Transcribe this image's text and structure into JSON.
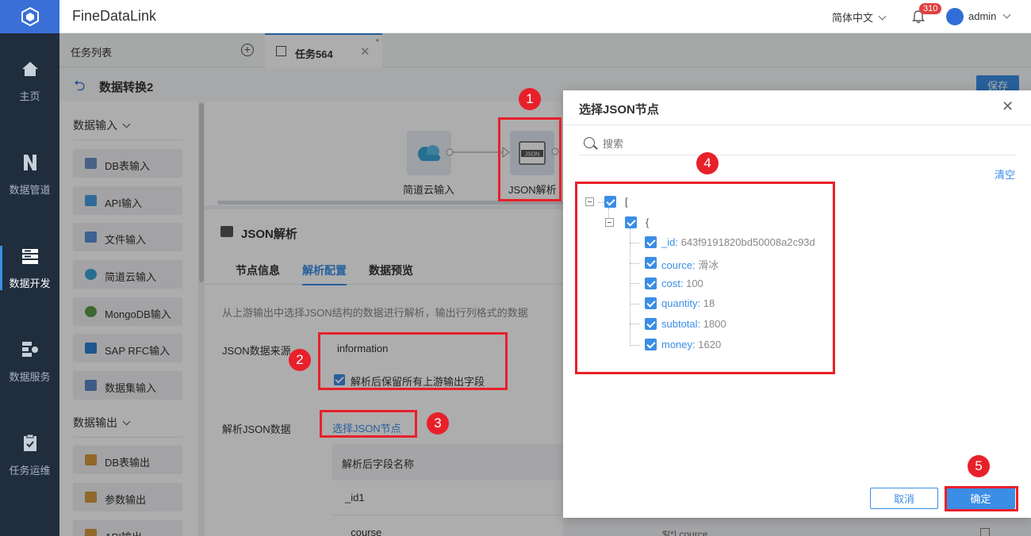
{
  "app": {
    "title": "FineDataLink"
  },
  "nav": {
    "items": [
      {
        "label": "主页"
      },
      {
        "label": "数据管道"
      },
      {
        "label": "数据开发"
      },
      {
        "label": "数据服务"
      },
      {
        "label": "任务运维"
      }
    ]
  },
  "header": {
    "language": "简体中文",
    "notification_count": "310",
    "user": "admin"
  },
  "tabs": {
    "list_label": "任务列表",
    "active_label": "任务564",
    "modified_mark": "*"
  },
  "flow": {
    "title": "数据转换2",
    "save_label": "保存"
  },
  "sidebar": {
    "input_section": "数据输入",
    "input_items": [
      {
        "label": "DB表输入",
        "icon": "db-table-icon"
      },
      {
        "label": "API输入",
        "icon": "api-icon"
      },
      {
        "label": "文件输入",
        "icon": "folder-icon"
      },
      {
        "label": "简道云输入",
        "icon": "jiandaoyun-icon"
      },
      {
        "label": "MongoDB输入",
        "icon": "mongodb-icon"
      },
      {
        "label": "SAP RFC输入",
        "icon": "sap-icon"
      },
      {
        "label": "数据集输入",
        "icon": "dataset-icon"
      }
    ],
    "output_section": "数据输出",
    "output_items": [
      {
        "label": "DB表输出",
        "icon": "db-table-icon"
      },
      {
        "label": "参数输出",
        "icon": "param-icon"
      },
      {
        "label": "API输出",
        "icon": "api-icon"
      }
    ]
  },
  "canvas": {
    "nodes": [
      {
        "label": "简道云输入"
      },
      {
        "label": "JSON解析",
        "badge": "JSON"
      }
    ]
  },
  "config": {
    "title": "JSON解析",
    "tabs": [
      {
        "label": "节点信息"
      },
      {
        "label": "解析配置"
      },
      {
        "label": "数据预览"
      }
    ],
    "active_tab": "解析配置",
    "description": "从上游输出中选择JSON结构的数据进行解析，输出行列格式的数据",
    "source_label": "JSON数据来源",
    "source_value": "information",
    "keep_fields_label": "解析后保留所有上游输出字段",
    "parse_label": "解析JSON数据",
    "select_button": "选择JSON节点",
    "table_header": "解析后字段名称",
    "rows": [
      {
        "name": "_id1"
      },
      {
        "name": "_course",
        "expr": "$[*].cource"
      }
    ]
  },
  "dialog": {
    "title": "选择JSON节点",
    "search_placeholder": "搜索",
    "clear_label": "清空",
    "tree": {
      "root": "[",
      "object": "{",
      "fields": [
        {
          "key": "_id:",
          "value": "643f9191820bd50008a2c93d"
        },
        {
          "key": "cource:",
          "value": "滑冰"
        },
        {
          "key": "cost:",
          "value": "100"
        },
        {
          "key": "quantity:",
          "value": "18"
        },
        {
          "key": "subtotal:",
          "value": "1800"
        },
        {
          "key": "money:",
          "value": "1620"
        }
      ]
    },
    "cancel_label": "取消",
    "ok_label": "确定"
  },
  "annotations": {
    "steps": [
      "1",
      "2",
      "3",
      "4",
      "5"
    ],
    "color": "#e8202a"
  },
  "colors": {
    "accent": "#3a8ee6",
    "nav_bg": "#1f2d3d",
    "logo_bg": "#3a6fd8"
  }
}
